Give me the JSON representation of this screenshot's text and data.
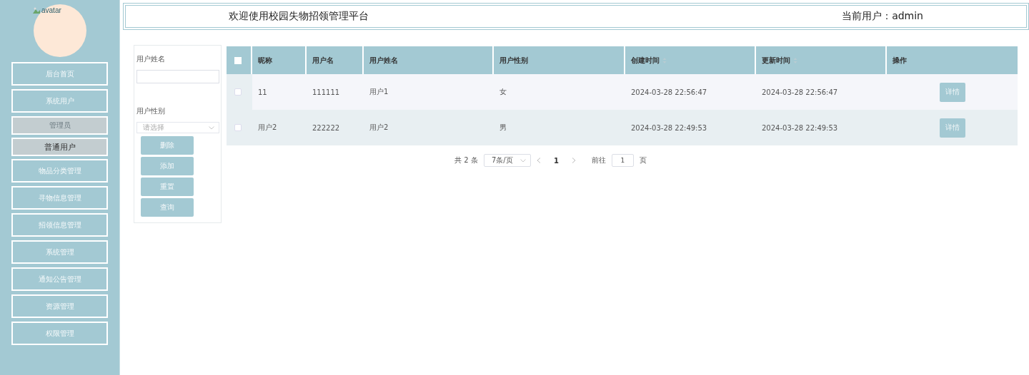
{
  "sidebar": {
    "avatar_alt": "avatar",
    "items": [
      {
        "label": "后台首页",
        "kind": "main",
        "selected": false
      },
      {
        "label": "系统用户",
        "kind": "main",
        "selected": false
      },
      {
        "label": "管理员",
        "kind": "sub",
        "selected": false
      },
      {
        "label": "普通用户",
        "kind": "sub",
        "selected": true
      },
      {
        "label": "物品分类管理",
        "kind": "main",
        "selected": false
      },
      {
        "label": "寻物信息管理",
        "kind": "main",
        "selected": false
      },
      {
        "label": "招领信息管理",
        "kind": "main",
        "selected": false
      },
      {
        "label": "系统管理",
        "kind": "main",
        "selected": false
      },
      {
        "label": "通知公告管理",
        "kind": "main",
        "selected": false
      },
      {
        "label": "资源管理",
        "kind": "main",
        "selected": false
      },
      {
        "label": "权限管理",
        "kind": "main",
        "selected": false
      }
    ]
  },
  "header": {
    "title": "欢迎使用校园失物招领管理平台",
    "current_user": "当前用户：admin"
  },
  "search": {
    "fields": [
      {
        "label": "用户姓名",
        "kind": "input"
      },
      {
        "label": "用户性别",
        "kind": "select",
        "placeholder": "请选择"
      }
    ],
    "buttons": [
      "删除",
      "添加",
      "重置",
      "查询"
    ]
  },
  "table": {
    "select_all_checked": false,
    "columns": [
      {
        "label": "昵称",
        "sortable": false
      },
      {
        "label": "用户名",
        "sortable": false
      },
      {
        "label": "用户姓名",
        "sortable": false
      },
      {
        "label": "用户性别",
        "sortable": false
      },
      {
        "label": "创建时间",
        "sortable": true
      },
      {
        "label": "更新时间",
        "sortable": true
      },
      {
        "label": "操作",
        "sortable": false
      }
    ],
    "rows": [
      {
        "checked": false,
        "cells": [
          "11",
          "111111",
          "用户1",
          "女",
          "2024-03-28 22:56:47",
          "2024-03-28 22:56:47"
        ],
        "action": "详情"
      },
      {
        "checked": false,
        "cells": [
          "用户2",
          "222222",
          "用户2",
          "男",
          "2024-03-28 22:49:53",
          "2024-03-28 22:49:53"
        ],
        "action": "详情"
      }
    ]
  },
  "pagination": {
    "total": "共 2 条",
    "page_size": "7条/页",
    "current_page": "1",
    "goto_label": "前往",
    "goto_value": "1",
    "goto_suffix": "页"
  }
}
